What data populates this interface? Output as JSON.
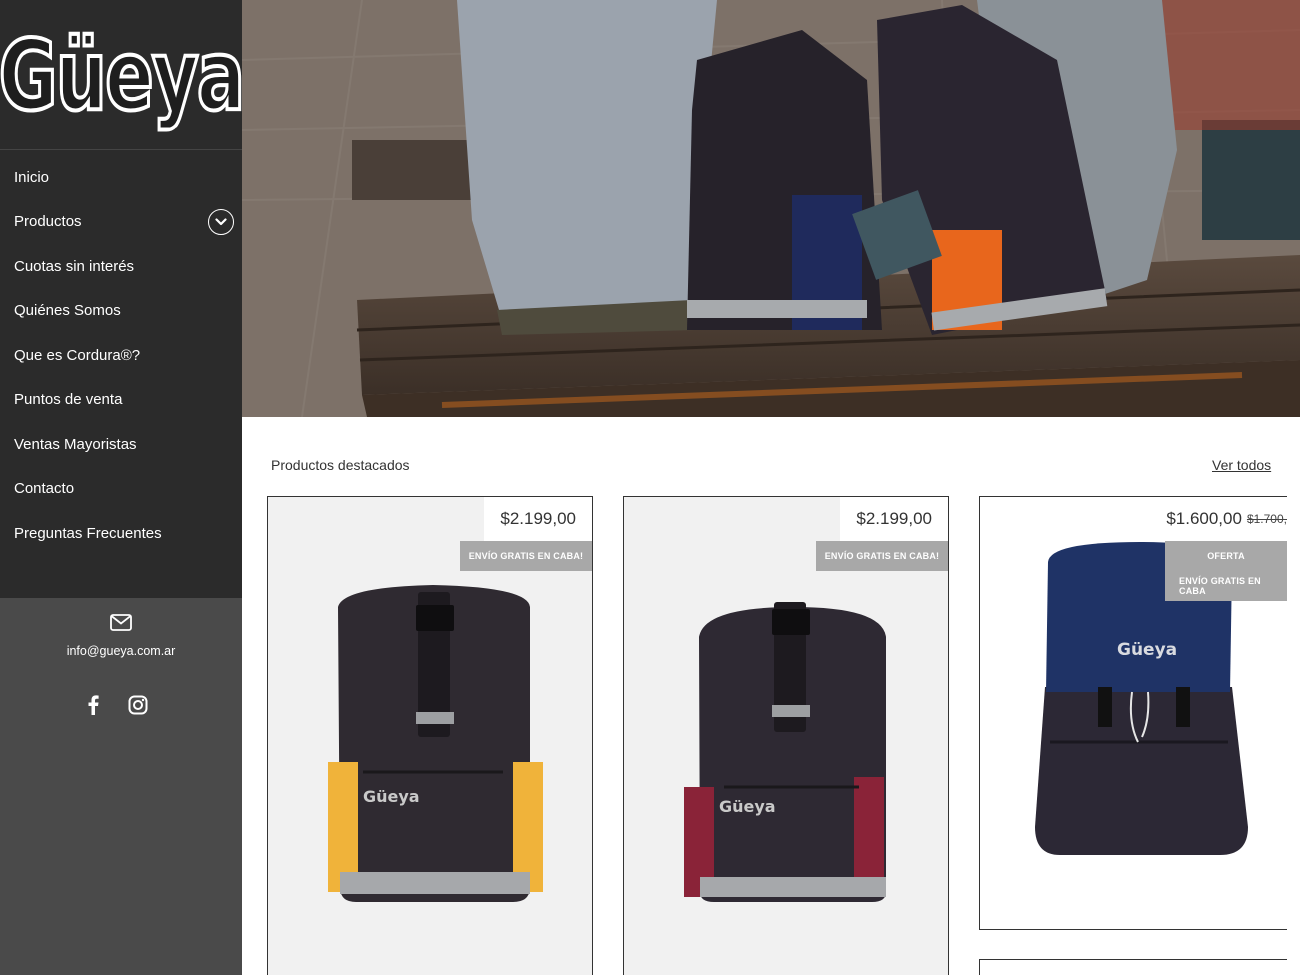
{
  "brand": {
    "logo_text": "Güeya"
  },
  "nav": {
    "items": [
      {
        "label": "Inicio"
      },
      {
        "label": "Productos",
        "has_submenu": true
      },
      {
        "label": "Cuotas sin interés"
      },
      {
        "label": "Quiénes Somos"
      },
      {
        "label": "Que es Cordura®?"
      },
      {
        "label": "Puntos de venta"
      },
      {
        "label": "Ventas Mayoristas"
      },
      {
        "label": "Contacto"
      },
      {
        "label": "Preguntas Frecuentes"
      }
    ]
  },
  "contact": {
    "email": "info@gueya.com.ar",
    "icons": [
      "mail-icon",
      "facebook-icon",
      "instagram-icon"
    ]
  },
  "products": {
    "title": "Productos destacados",
    "see_all": "Ver todos",
    "items": [
      {
        "price": "$2.199,00",
        "badges": [
          "ENVÍO GRATIS EN CABA!"
        ],
        "accent_color": "#e8a93a"
      },
      {
        "price": "$2.199,00",
        "badges": [
          "ENVÍO GRATIS EN CABA!"
        ],
        "accent_color": "#8a2338"
      },
      {
        "price": "$1.600,00",
        "old_price": "$1.700,",
        "badges": [
          "OFERTA",
          "ENVÍO GRATIS EN CABA"
        ],
        "accent_color": "#1f3366"
      }
    ]
  },
  "colors": {
    "sidebar_bg": "#2b2b2b",
    "sidebar_footer_bg": "#4a4a4a",
    "badge_bg": "#a8a8a8"
  }
}
